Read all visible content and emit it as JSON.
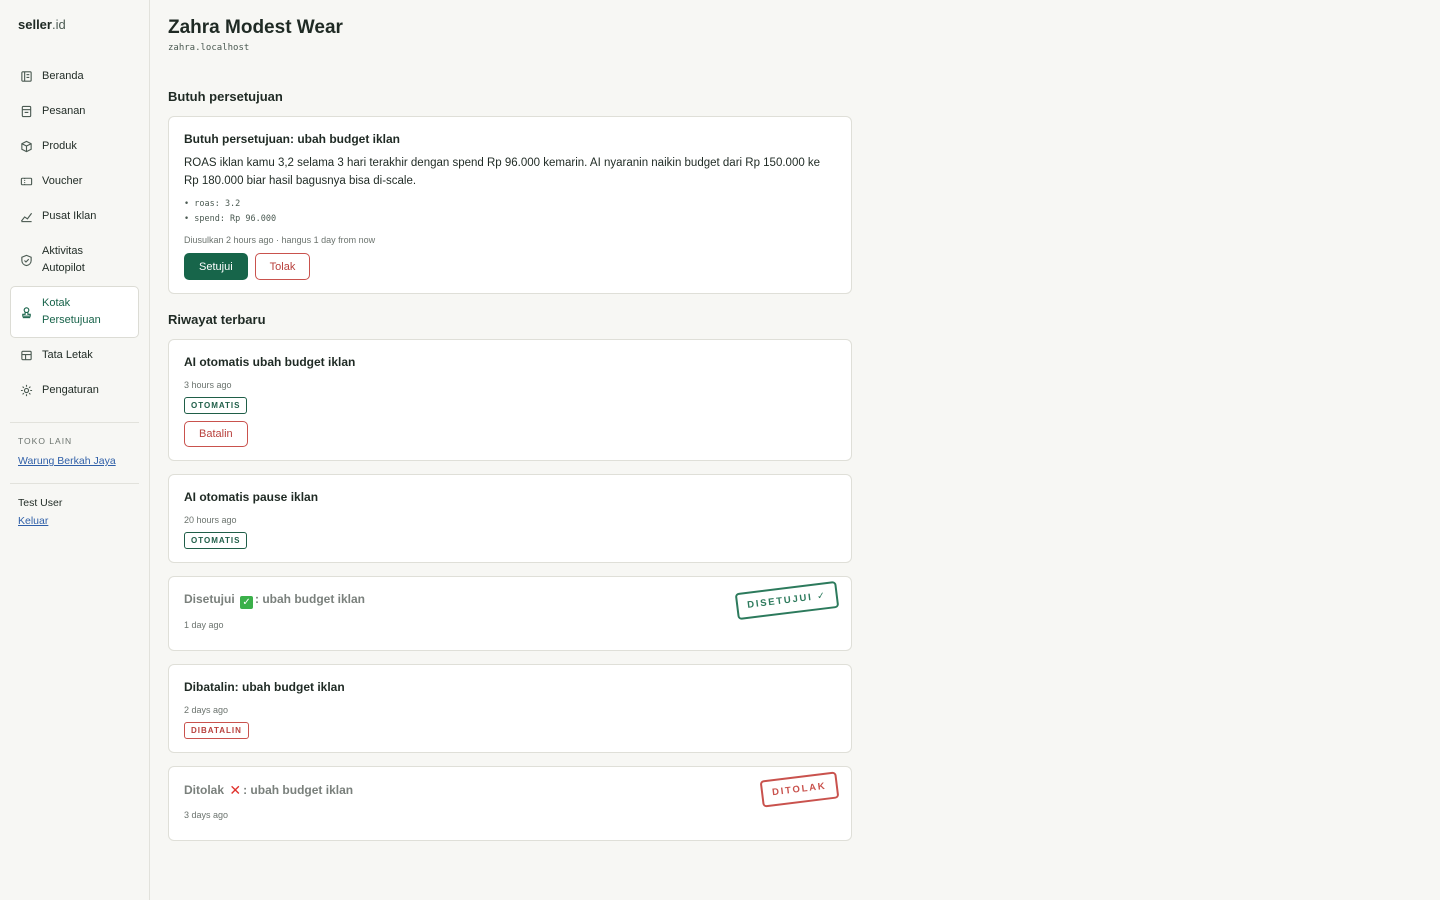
{
  "brand": {
    "name": "seller",
    "suffix": ".id"
  },
  "nav": {
    "items": [
      {
        "label": "Beranda",
        "icon": "home-icon"
      },
      {
        "label": "Pesanan",
        "icon": "orders-icon"
      },
      {
        "label": "Produk",
        "icon": "box-icon"
      },
      {
        "label": "Voucher",
        "icon": "ticket-icon"
      },
      {
        "label": "Pusat Iklan",
        "icon": "chart-icon"
      },
      {
        "label": "Aktivitas Autopilot",
        "icon": "shield-icon"
      },
      {
        "label": "Kotak Persetujuan",
        "icon": "stamp-icon",
        "active": true
      },
      {
        "label": "Tata Letak",
        "icon": "layout-icon"
      },
      {
        "label": "Pengaturan",
        "icon": "gear-icon"
      }
    ],
    "other_stores_label": "TOKO LAIN",
    "other_stores": [
      "Warung Berkah Jaya"
    ],
    "user_name": "Test User",
    "logout_label": "Keluar"
  },
  "store": {
    "title": "Zahra Modest Wear",
    "domain": "zahra.localhost"
  },
  "pending": {
    "section_title": "Butuh persetujuan",
    "card": {
      "title": "Butuh persetujuan: ubah budget iklan",
      "description": "ROAS iklan kamu 3,2 selama 3 hari terakhir dengan spend Rp 96.000 kemarin. AI nyaranin naikin budget dari Rp 150.000 ke Rp 180.000 biar hasil bagusnya bisa di-scale.",
      "bullets": [
        "• roas: 3.2",
        "• spend: Rp 96.000"
      ],
      "meta": "Diusulkan 2 hours ago · hangus 1 day from now",
      "approve_label": "Setujui",
      "reject_label": "Tolak"
    }
  },
  "history": {
    "section_title": "Riwayat terbaru",
    "items": [
      {
        "title": "AI otomatis ubah budget iklan",
        "time": "3 hours ago",
        "badge": "OTOMATIS",
        "button": "Batalin"
      },
      {
        "title": "AI otomatis pause iklan",
        "time": "20 hours ago",
        "badge": "OTOMATIS"
      },
      {
        "title_pre": "Disetujui",
        "title_post": ": ubah budget iklan",
        "time": "1 day ago",
        "stamp": "DISETUJUI ✓"
      },
      {
        "title": "Dibatalin: ubah budget iklan",
        "time": "2 days ago",
        "badge": "DIBATALIN"
      },
      {
        "title_pre": "Ditolak",
        "title_post": ": ubah budget iklan",
        "time": "3 days ago",
        "stamp": "DITOLAK"
      }
    ]
  },
  "colors": {
    "accent": "#17654a",
    "danger": "#c9524d",
    "link": "#2f5fa8"
  }
}
